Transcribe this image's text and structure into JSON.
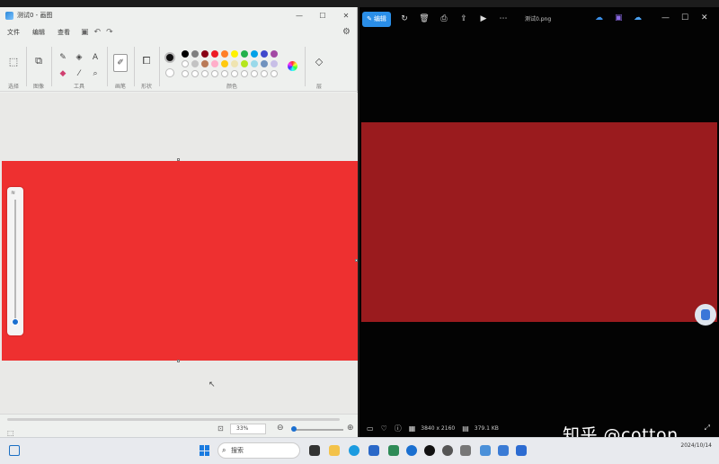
{
  "paint": {
    "title": "测试0 - 画图",
    "menu": [
      "文件",
      "编辑",
      "查看"
    ],
    "groups": {
      "select": "选择",
      "image": "图像",
      "tools": "工具",
      "brushes": "画笔",
      "shapes": "形状",
      "colors": "颜色",
      "layers": "层"
    },
    "palette_row1": [
      "#000000",
      "#7f7f7f",
      "#880015",
      "#ed1c24",
      "#ff7f27",
      "#fff200",
      "#22b14c",
      "#00a2e8",
      "#3f48cc",
      "#a349a4"
    ],
    "palette_row2": [
      "#ffffff",
      "#c3c3c3",
      "#b97a57",
      "#ffaec9",
      "#ffc90e",
      "#efe4b0",
      "#b5e61d",
      "#99d9ea",
      "#7092be",
      "#c8bfe7"
    ],
    "canvas_color": "#ee3030",
    "zoom_value": "33%"
  },
  "photos": {
    "edit_label": "编辑",
    "filename": "测试0.png",
    "image_color": "#9a1b1e",
    "dimensions": "3840 x 2160",
    "file_size": "379.1 KB"
  },
  "taskbar": {
    "search_placeholder": "搜索",
    "date": "2024/10/14"
  },
  "watermark": "知乎 @cotton"
}
